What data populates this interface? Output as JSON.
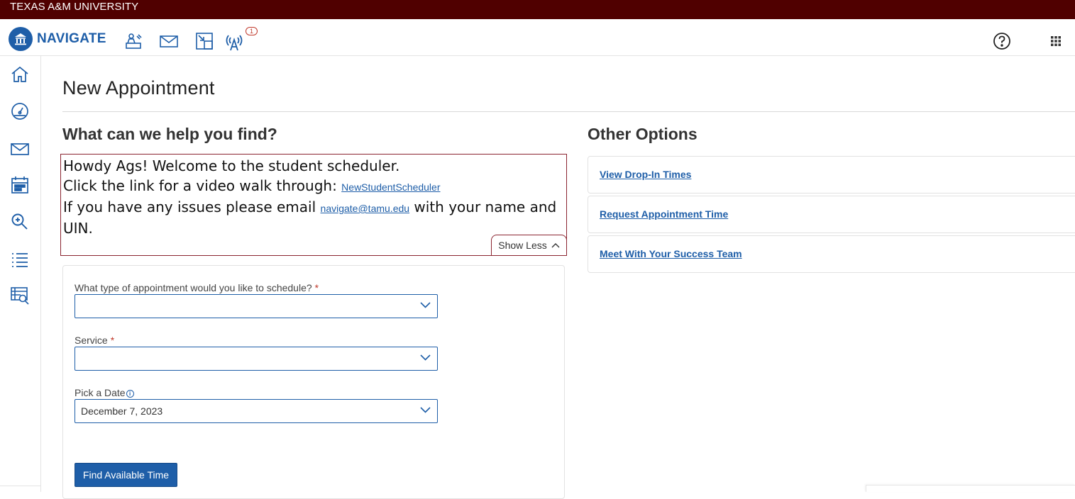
{
  "topbar": {
    "university": "TEXAS A&M UNIVERSITY"
  },
  "navbar": {
    "logo_text": "NAVIGATE",
    "icons": [
      "person-desk-icon",
      "mail-icon",
      "resize-icon",
      "antenna-icon",
      "help-icon",
      "apps-grid-icon"
    ],
    "badge_count": "1"
  },
  "sidebar": {
    "icons": [
      "home-icon",
      "dashboard-icon",
      "mail-icon",
      "calendar-icon",
      "search-icon",
      "list-icon",
      "report-search-icon"
    ]
  },
  "page": {
    "title": "New Appointment"
  },
  "left": {
    "heading": "What can we help you find?",
    "info": {
      "line1": "Howdy Ags!  Welcome to the student scheduler.",
      "line2_prefix": "Click the link for a video walk through: ",
      "line2_link": "NewStudentScheduler",
      "line3_prefix": "If you have any issues please email ",
      "line3_link": "navigate@tamu.edu",
      "line3_suffix": " with your name and UIN.",
      "toggle_label": "Show Less"
    },
    "form": {
      "type_label": "What type of appointment would you like to schedule?",
      "type_value": "",
      "service_label": "Service",
      "service_value": "",
      "date_label": "Pick a Date",
      "date_value": "December 7, 2023",
      "required_marker": "*",
      "submit_label": "Find Available Time"
    }
  },
  "right": {
    "heading": "Other Options",
    "options": [
      {
        "label": "View Drop-In Times"
      },
      {
        "label": "Request Appointment Time"
      },
      {
        "label": "Meet With Your Success Team"
      }
    ]
  },
  "colors": {
    "maroon": "#500000",
    "accent": "#1e5ea8",
    "required": "#c0392b"
  }
}
